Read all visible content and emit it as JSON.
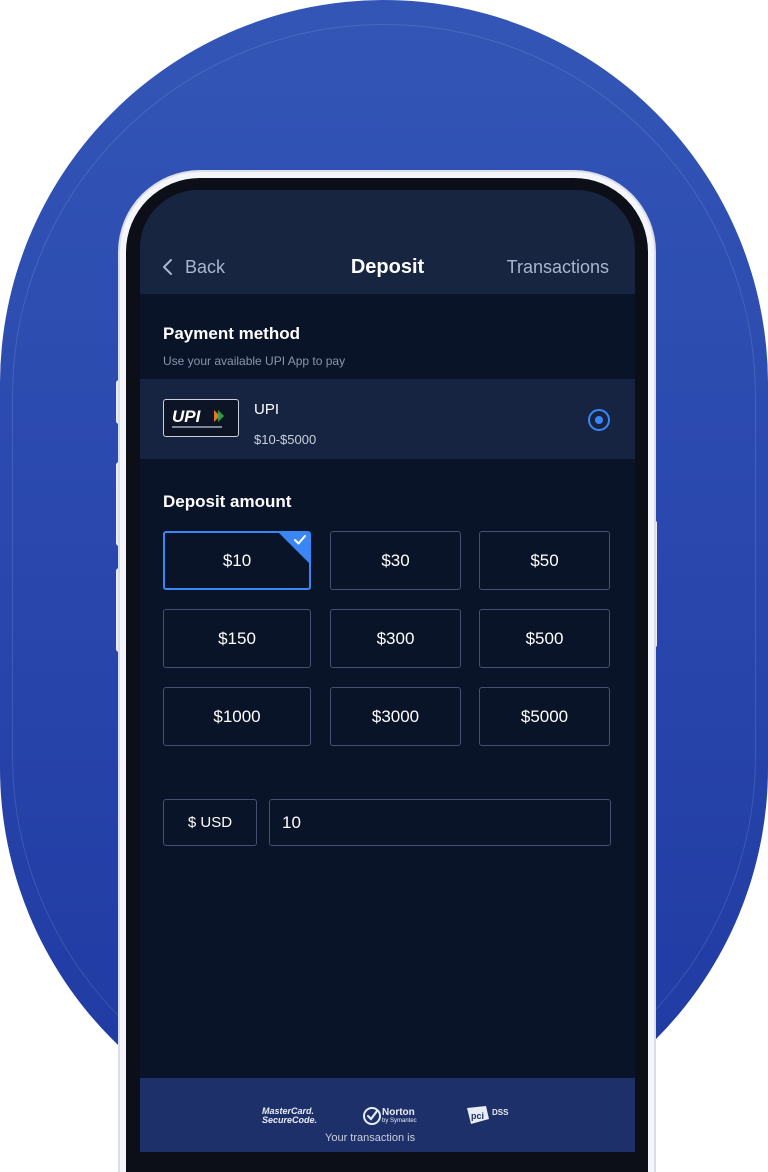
{
  "header": {
    "back_label": "Back",
    "title": "Deposit",
    "transactions_label": "Transactions"
  },
  "payment_method": {
    "title": "Payment method",
    "subtitle": "Use your available UPI App to pay",
    "option": {
      "logo_text": "UPI",
      "name": "UPI",
      "range": "$10-$5000",
      "selected": true
    }
  },
  "deposit_amount": {
    "title": "Deposit amount",
    "selected": "$10",
    "options": [
      "$10",
      "$30",
      "$50",
      "$150",
      "$300",
      "$500",
      "$1000",
      "$3000",
      "$5000"
    ]
  },
  "amount_field": {
    "currency": "$ USD",
    "value": "10"
  },
  "footer": {
    "badges": [
      {
        "line1": "MasterCard.",
        "line2": "SecureCode."
      },
      {
        "line1": "Norton",
        "line2": "by Symantec"
      },
      {
        "line1": "DSS",
        "line2": ""
      }
    ],
    "note": "Your transaction is"
  },
  "colors": {
    "background_blue": "#2a48ae",
    "screen": "#0a1428",
    "header": "#172541",
    "accent": "#3a86f5",
    "border": "#445170"
  }
}
